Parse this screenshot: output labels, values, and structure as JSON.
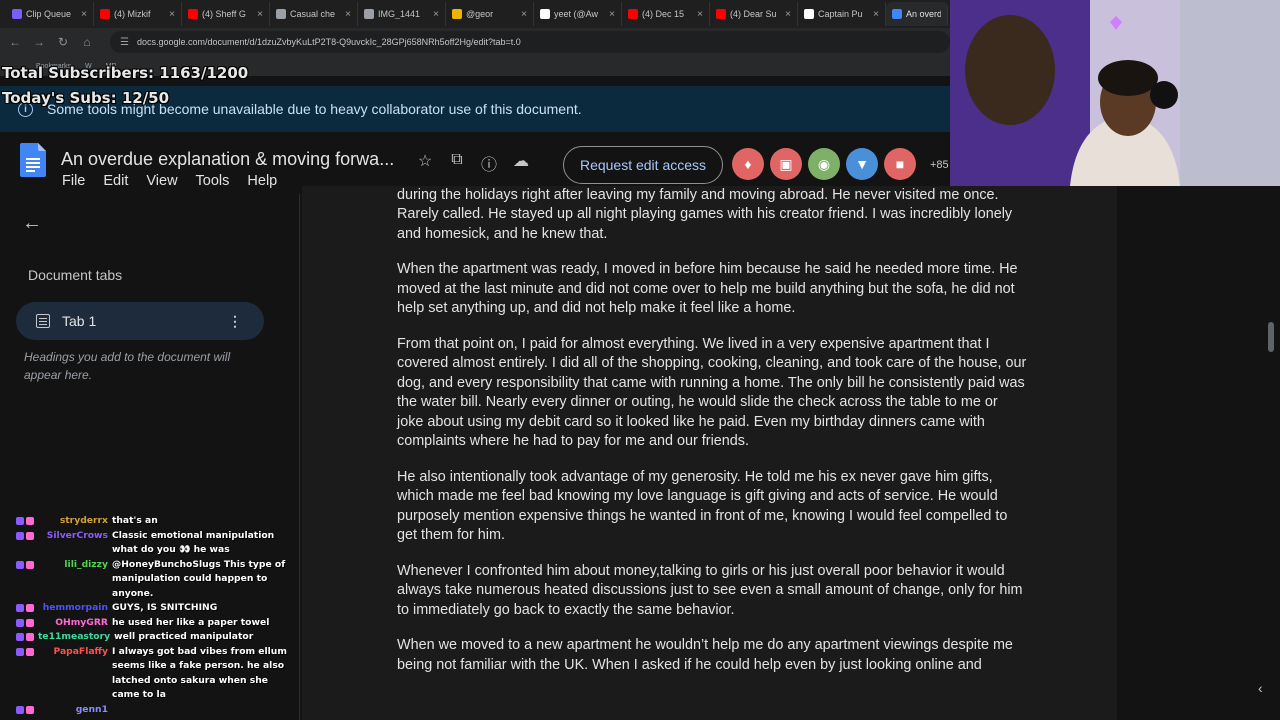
{
  "browser": {
    "tabs": [
      {
        "label": "Clip Queue",
        "color": "#7b5cff"
      },
      {
        "label": "(4) Mizkif",
        "color": "#ff0000"
      },
      {
        "label": "(4) Sheff G",
        "color": "#ff0000"
      },
      {
        "label": "Casual che",
        "color": "#9aa0a6"
      },
      {
        "label": "IMG_1441",
        "color": "#9aa0a6"
      },
      {
        "label": "@geor",
        "color": "#f0b400"
      },
      {
        "label": "yeet (@Aw",
        "color": "#ffffff"
      },
      {
        "label": "(4) Dec 15",
        "color": "#ff0000"
      },
      {
        "label": "(4) Dear Su",
        "color": "#ff0000"
      },
      {
        "label": "Captain Pu",
        "color": "#ffffff"
      },
      {
        "label": "An overdu",
        "color": "#4285f4"
      }
    ],
    "url": "docs.google.com/document/d/1dzuZvbyKuLtP2T8-Q9uvckIc_28GPj658NRh5off2Hg/edit?tab=t.0",
    "bookmarks": [
      "Bookmarks",
      "W",
      "MR"
    ]
  },
  "overlay": {
    "total_subs": "Total Subscribers: 1163/1200",
    "today_subs": "Today's Subs: 12/50"
  },
  "banner": {
    "text": "Some tools might become unavailable due to heavy collaborator use of this document."
  },
  "doc": {
    "title": "An overdue explanation & moving forwa...",
    "menu": [
      "File",
      "Edit",
      "View",
      "Tools",
      "Help"
    ],
    "request_label": "Request edit access",
    "more_count": "+85",
    "avatar_colors": [
      "#e06666",
      "#e06666",
      "#7fb069",
      "#4a90d9",
      "#e06666"
    ]
  },
  "sidebar": {
    "section_label": "Document tabs",
    "tab_label": "Tab 1",
    "hint": "Headings you add to the document will appear here."
  },
  "chat": [
    {
      "user": "stryderrx",
      "text": "that's an",
      "color": "#d6a030"
    },
    {
      "user": "SilverCrows",
      "text": "Classic emotional manipulation what do you 👀 he was",
      "color": "#8a5cff"
    },
    {
      "user": "lili_dizzy",
      "text": "@HoneyBunchoSlugs This type of manipulation could happen to anyone.",
      "color": "#54d354"
    },
    {
      "user": "hemmorpain",
      "text": "GUYS, IS SNITCHING",
      "color": "#5050ff"
    },
    {
      "user": "OHmyGRR",
      "text": "he used her like a paper towel",
      "color": "#ff69d4"
    },
    {
      "user": "te11meastory",
      "text": "well practiced manipulator",
      "color": "#3ddb9c"
    },
    {
      "user": "PapaFlaffy",
      "text": "I always got bad vibes from ellum seems like a fake person. he also latched onto sakura when she came to la",
      "color": "#ff5050"
    },
    {
      "user": "genn1",
      "text": "",
      "color": "#8a8aff"
    }
  ],
  "paragraphs": [
    "with his womenfolk there. To be fair, I spent thousands of dollars alone in a hotel in central London during the holidays right after leaving my family and moving abroad. He never visited me once. Rarely called. He stayed up all night playing games with his creator friend. I was incredibly lonely and homesick, and he knew that.",
    "When the apartment was ready, I moved in before him because he said he needed more time. He moved at the last minute and did not come over to help me build anything but the sofa, he did not help set anything up, and did not help make it feel like a home.",
    "From that point on, I paid for almost everything. We lived in a very expensive apartment that I covered almost entirely. I did all of the shopping, cooking, cleaning, and took care of the house, our dog, and every responsibility that came with running a home. The only bill he consistently paid was the water bill. Nearly every dinner or outing, he would slide the check across the table to me or joke about using my debit card so it looked like he paid. Even my birthday dinners came with complaints where he had to pay for me and our friends.",
    "He also intentionally took advantage of my generosity. He told me his ex never gave him gifts, which made me feel bad knowing my love language is gift giving and acts of service. He would purposely mention expensive things he wanted in front of me, knowing I would feel compelled to get them for him.",
    "Whenever I confronted him about money,talking to girls or his just overall poor behavior it would always take numerous heated discussions just to see even a small amount of change, only for him to immediately go back to exactly the same behavior.",
    "When we moved to a new apartment he wouldn’t help me do any apartment viewings despite me being not familiar with the UK. When I asked if he could help even by just looking online and"
  ]
}
